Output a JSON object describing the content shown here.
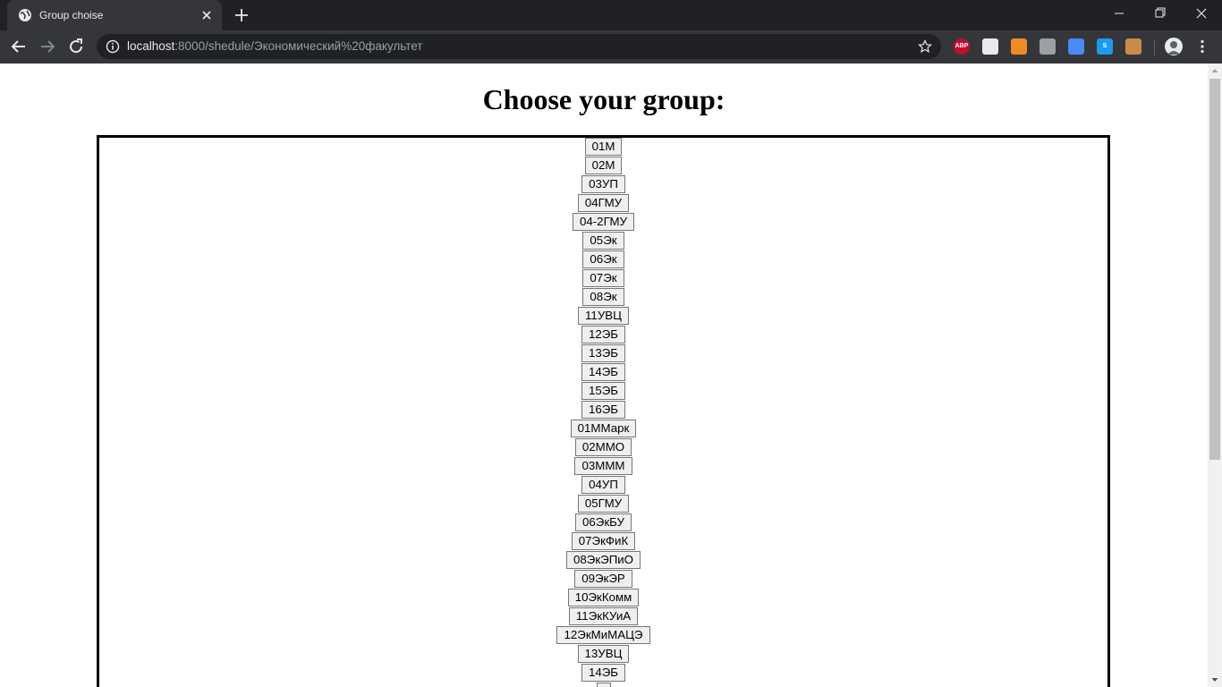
{
  "browser": {
    "tab_title": "Group choise",
    "url_host": "localhost",
    "url_rest": ":8000/shedule/Экономический%20факультет",
    "extensions": [
      {
        "name": "adblock-plus-icon",
        "color": "#c70d2c",
        "label": "ABP"
      },
      {
        "name": "calendar-extension-icon",
        "color": "#e8eaed",
        "label": ""
      },
      {
        "name": "basketball-extension-icon",
        "color": "#f08a24",
        "label": ""
      },
      {
        "name": "ninja-extension-icon",
        "color": "#9aa0a6",
        "label": ""
      },
      {
        "name": "google-translate-icon",
        "color": "#4a8af4",
        "label": ""
      },
      {
        "name": "skype-extension-icon",
        "color": "#1a9bf0",
        "label": "S"
      },
      {
        "name": "cookie-extension-icon",
        "color": "#c98b4a",
        "label": ""
      }
    ]
  },
  "page": {
    "title": "Choose your group:",
    "groups": [
      "01М",
      "02М",
      "03УП",
      "04ГМУ",
      "04-2ГМУ",
      "05Эк",
      "06Эк",
      "07Эк",
      "08Эк",
      "11УВЦ",
      "12ЭБ",
      "13ЭБ",
      "14ЭБ",
      "15ЭБ",
      "16ЭБ",
      "01ММарк",
      "02ММО",
      "03МММ",
      "04УП",
      "05ГМУ",
      "06ЭкБУ",
      "07ЭкФиК",
      "08ЭкЭПиО",
      "09ЭкЭР",
      "10ЭкКомм",
      "11ЭкКУиА",
      "12ЭкМиМАЦЭ",
      "13УВЦ",
      "14ЭБ",
      ""
    ]
  }
}
